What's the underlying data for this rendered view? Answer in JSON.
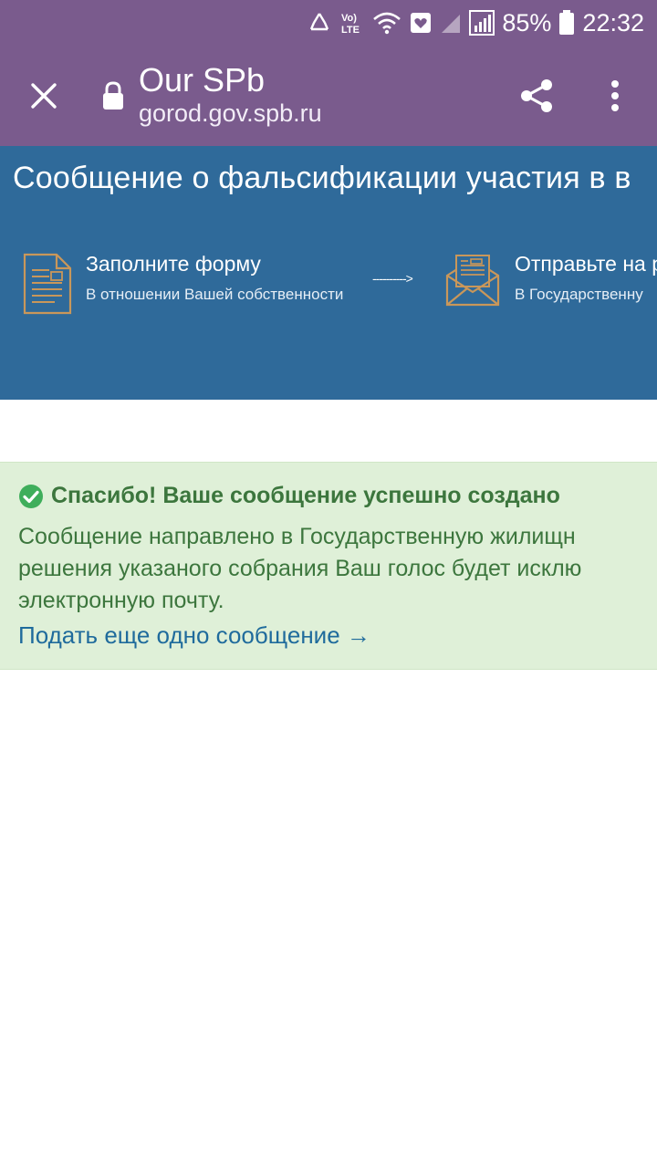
{
  "status_bar": {
    "battery_percent": "85%",
    "time": "22:32",
    "network_label": "Vo) LTE"
  },
  "toolbar": {
    "site_title": "Our SPb",
    "site_url": "gorod.gov.spb.ru"
  },
  "banner": {
    "title": "Сообщение о фальсификации участия в в",
    "steps": [
      {
        "title": "Заполните форму",
        "subtitle": "В отношении Вашей собственности"
      },
      {
        "title": "Отправьте на р",
        "subtitle": "В Государственну"
      }
    ],
    "arrow": "---------->"
  },
  "alert": {
    "title": "Спасибо! Ваше сообщение успешно создано",
    "body_lines": [
      "Сообщение направлено в Государственную жилищн",
      "решения указаного собрания Ваш голос будет исклю",
      "электронную почту."
    ],
    "link_text": "Подать еще одно сообщение →"
  },
  "colors": {
    "toolbar": "#7a5b8d",
    "banner": "#2f6a9a",
    "alert_bg": "#dff0d8",
    "alert_text": "#3c763d",
    "link": "#1f6b9c",
    "icon_accent": "#c9975a",
    "success_icon": "#3fae5b"
  }
}
